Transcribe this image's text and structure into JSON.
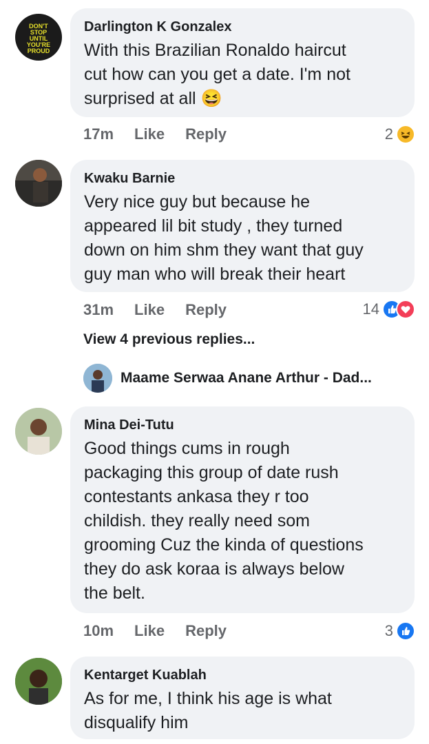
{
  "comments": [
    {
      "author": "Darlington K Gonzalex",
      "text": "With this Brazilian Ronaldo haircut\ncut how can you get a date. I'm not\nsurprised at all 😆",
      "time": "17m",
      "like": "Like",
      "reply": "Reply",
      "reaction_count": "2",
      "reactions": [
        "haha"
      ],
      "avatar_text": "DON'T STOP UNTIL YOU'RE PROUD"
    },
    {
      "author": "Kwaku  Barnie",
      "text": "Very nice guy but because he\nappeared lil bit study , they turned\ndown on him shm they want that guy\nguy man who will break their heart",
      "time": "31m",
      "like": "Like",
      "reply": "Reply",
      "reaction_count": "14",
      "reactions": [
        "like",
        "love"
      ]
    },
    {
      "author": "Mina Dei-Tutu",
      "text": "Good things cums in rough\npackaging this group of date rush\ncontestants ankasa they r too\nchildish. they really need som\ngrooming Cuz the kinda of questions\nthey do ask koraa is always below\nthe belt.",
      "time": "10m",
      "like": "Like",
      "reply": "Reply",
      "reaction_count": "3",
      "reactions": [
        "like"
      ]
    },
    {
      "author": "Kentarget Kuablah",
      "text": "As for me, I think his age is what\ndisqualify him"
    }
  ],
  "view_previous_replies": "View 4 previous replies...",
  "reply_preview": {
    "author": "Maame Serwaa Anane Arthur - Dad..."
  }
}
